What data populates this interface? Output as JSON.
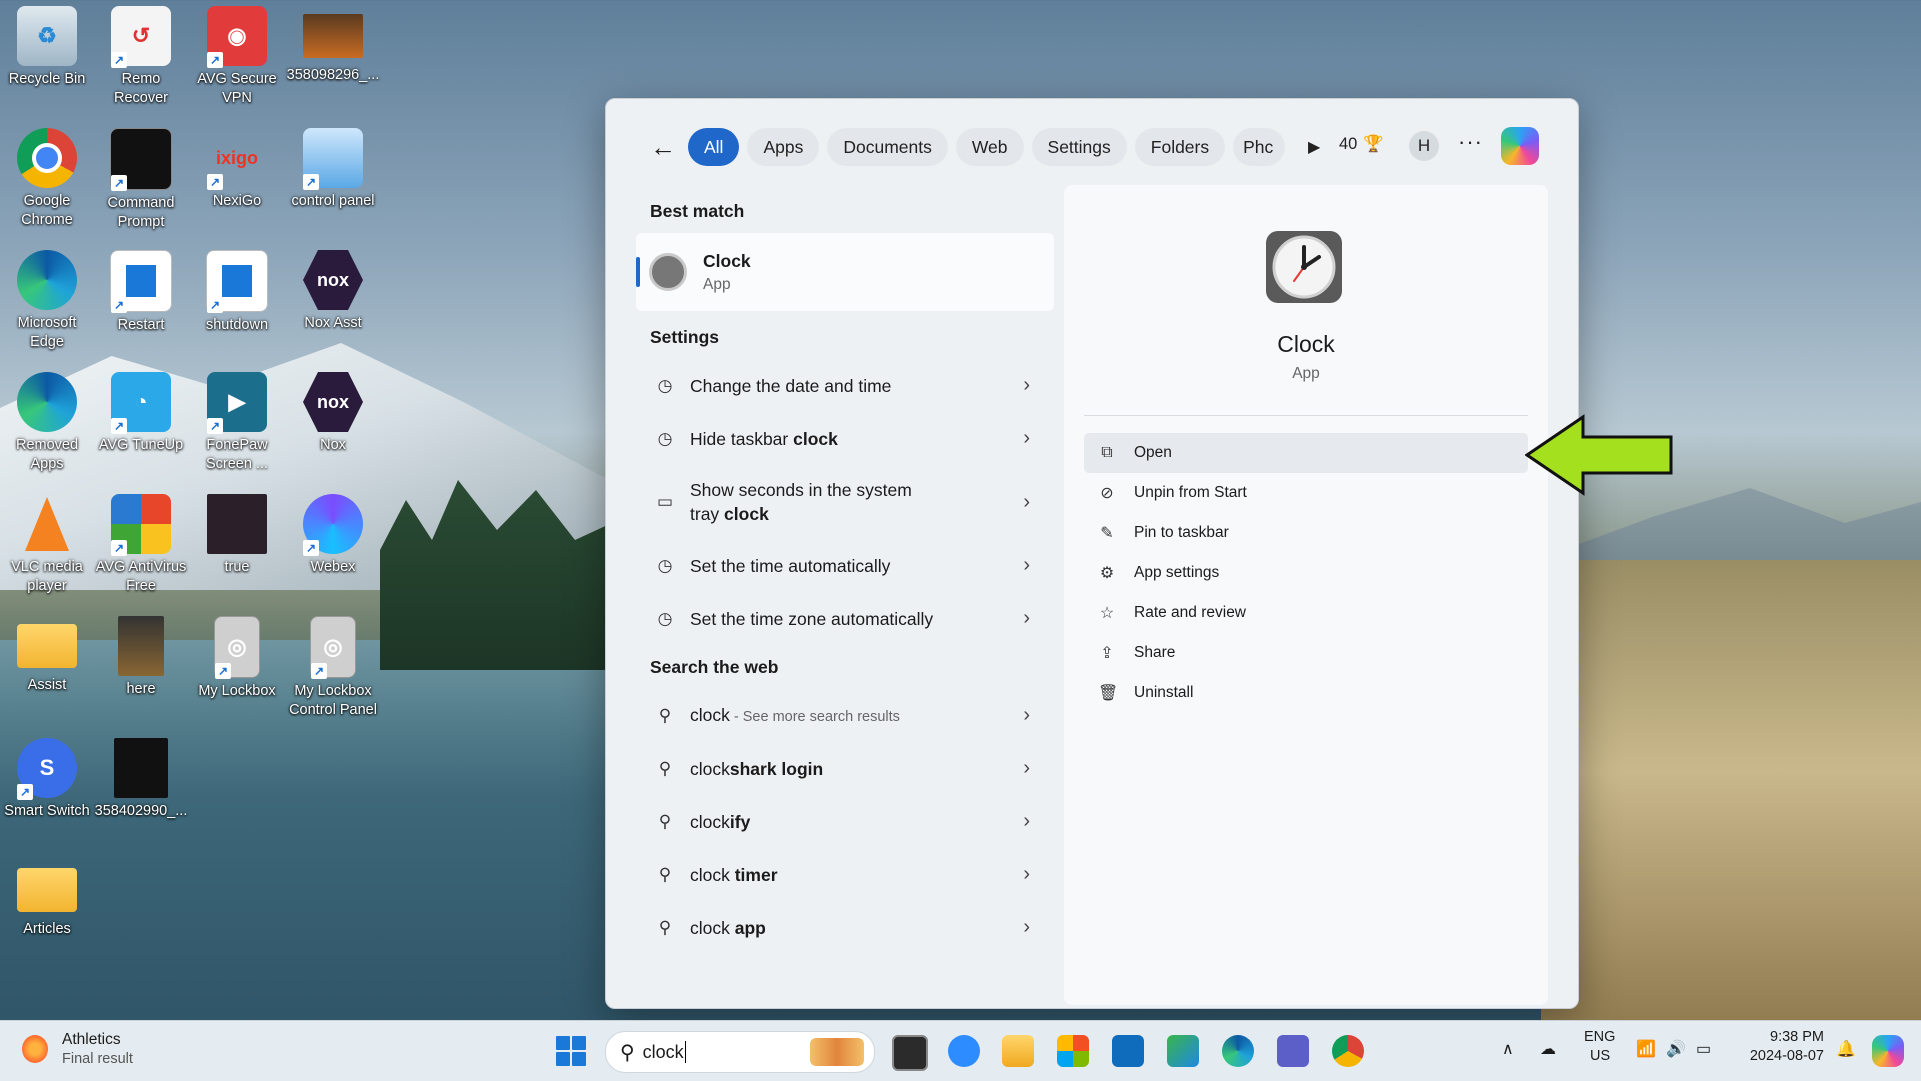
{
  "desktop": {
    "icons": [
      {
        "label": "Recycle Bin"
      },
      {
        "label": "Remo Recover"
      },
      {
        "label": "AVG Secure VPN"
      },
      {
        "label": "358098296_..."
      },
      {
        "label": "Google Chrome"
      },
      {
        "label": "Command Prompt"
      },
      {
        "label": "NexiGo"
      },
      {
        "label": "control panel"
      },
      {
        "label": "Microsoft Edge"
      },
      {
        "label": "Restart"
      },
      {
        "label": "shutdown"
      },
      {
        "label": "Nox Asst"
      },
      {
        "label": "Removed Apps"
      },
      {
        "label": "AVG TuneUp"
      },
      {
        "label": "FonePaw Screen ..."
      },
      {
        "label": "Nox"
      },
      {
        "label": "VLC media player"
      },
      {
        "label": "AVG AntiVirus Free"
      },
      {
        "label": "true"
      },
      {
        "label": "Webex"
      },
      {
        "label": "Assist"
      },
      {
        "label": "here"
      },
      {
        "label": "My Lockbox"
      },
      {
        "label": "My Lockbox Control Panel"
      },
      {
        "label": "Smart Switch"
      },
      {
        "label": "358402990_..."
      },
      {
        "label": "Articles"
      }
    ]
  },
  "search": {
    "tabs": [
      "All",
      "Apps",
      "Documents",
      "Web",
      "Settings",
      "Folders",
      "Phc"
    ],
    "points": "40",
    "avatar": "H",
    "more": "···",
    "best_match_heading": "Best match",
    "best_match": {
      "title": "Clock",
      "subtitle": "App"
    },
    "settings_heading": "Settings",
    "settings": [
      {
        "pre": "Change the date and time",
        "bold": "",
        "post": ""
      },
      {
        "pre": "Hide taskbar ",
        "bold": "clock",
        "post": ""
      },
      {
        "pre": "Show seconds in the system tray ",
        "bold": "clock",
        "post": ""
      },
      {
        "pre": "Set the time automatically",
        "bold": "",
        "post": ""
      },
      {
        "pre": "Set the time zone automatically",
        "bold": "",
        "post": ""
      }
    ],
    "web_heading": "Search the web",
    "web": [
      {
        "pre": "clock",
        "bold": "",
        "sub": " - See more search results"
      },
      {
        "pre": "clock",
        "bold": "shark login",
        "sub": ""
      },
      {
        "pre": "clock",
        "bold": "ify",
        "sub": ""
      },
      {
        "pre": "clock ",
        "bold": "timer",
        "sub": ""
      },
      {
        "pre": "clock ",
        "bold": "app",
        "sub": ""
      }
    ],
    "detail": {
      "title": "Clock",
      "subtitle": "App",
      "actions": [
        {
          "label": "Open",
          "icon": "open-icon"
        },
        {
          "label": "Unpin from Start",
          "icon": "unpin-icon"
        },
        {
          "label": "Pin to taskbar",
          "icon": "pin-icon"
        },
        {
          "label": "App settings",
          "icon": "gear-icon"
        },
        {
          "label": "Rate and review",
          "icon": "star-icon"
        },
        {
          "label": "Share",
          "icon": "share-icon"
        },
        {
          "label": "Uninstall",
          "icon": "trash-icon"
        }
      ]
    }
  },
  "taskbar": {
    "weather_title": "Athletics",
    "weather_sub": "Final result",
    "search_value": "clock",
    "lang_1": "ENG",
    "lang_2": "US",
    "time": "9:38 PM",
    "date": "2024-08-07"
  },
  "colors": {
    "accent": "#1f67c8",
    "arrow": "#a5e01e"
  }
}
